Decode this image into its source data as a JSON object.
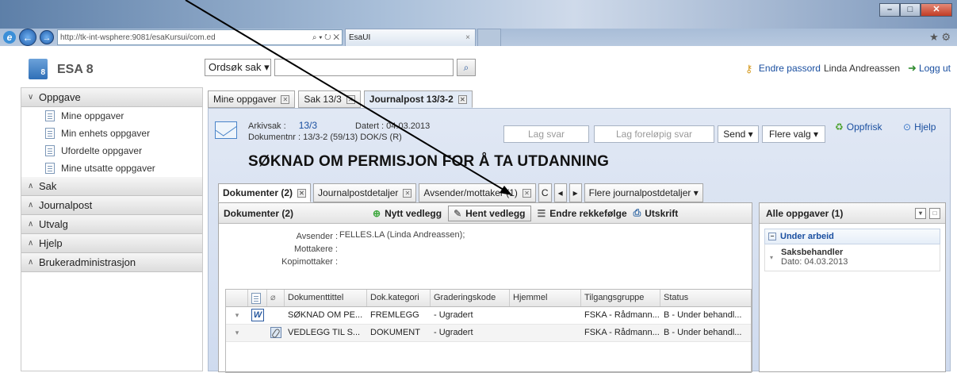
{
  "browser": {
    "address_url": "http://tk-int-wsphere:9081/esaKursui/com.ed",
    "address_host": "tk-int-wsphere",
    "address_tools": "⌕ ▾ ↻ ✕",
    "tab_title": "EsaUI",
    "tab_close": "×",
    "min": "–",
    "max": "□",
    "close": "✕",
    "star": "★ ⚙"
  },
  "app": {
    "logo_num": "8",
    "name": "ESA 8",
    "search_select": "Ordsøk sak ▾",
    "search_icon": "⌕",
    "change_password": "Endre passord",
    "username": "Linda Andreassen",
    "logout": "Logg ut"
  },
  "sidebar": {
    "sections": [
      {
        "label": "Oppgave",
        "chev": "∨"
      },
      {
        "label": "Sak",
        "chev": "∧"
      },
      {
        "label": "Journalpost",
        "chev": "∧"
      },
      {
        "label": "Utvalg",
        "chev": "∧"
      },
      {
        "label": "Hjelp",
        "chev": "∧"
      },
      {
        "label": "Brukeradministrasjon",
        "chev": "∧"
      }
    ],
    "oppgave_items": [
      "Mine oppgaver",
      "Min enhets oppgaver",
      "Ufordelte oppgaver",
      "Mine utsatte oppgaver"
    ]
  },
  "main_tabs": [
    "Mine oppgaver",
    "Sak 13/3",
    "Journalpost 13/3-2"
  ],
  "journal": {
    "arkivsak_label": "Arkivsak :",
    "arkivsak_value": "13/3",
    "datert": "Datert : 04.03.2013",
    "dokumentnr": "Dokumentnr : 13/3-2 (59/13) DOK/S (R)",
    "title": "SØKNAD OM PERMISJON FOR Å TA UTDANNING",
    "btn_lag_svar": "Lag svar",
    "btn_lag_foreløpig": "Lag foreløpig svar",
    "btn_send": "Send ▾",
    "btn_flere": "Flere valg ▾",
    "oppfrisk": "Oppfrisk",
    "hjelp": "Hjelp"
  },
  "doc_tabs": [
    "Dokumenter (2)",
    "Journalpostdetaljer",
    "Avsender/mottaker (1)",
    "C",
    "◂",
    "▸",
    "Flere journalpostdetaljer ▾"
  ],
  "docpanel": {
    "title": "Dokumenter (2)",
    "nytt": "Nytt vedlegg",
    "hent": "Hent vedlegg",
    "endre": "Endre rekkefølge",
    "utskrift": "Utskrift",
    "avsender_label": "Avsender :",
    "avsender_value": "FELLES.LA (Linda Andreassen);",
    "mottakere_label": "Mottakere :",
    "kopi_label": "Kopimottaker :",
    "columns": [
      "Dokumenttittel",
      "Dok.kategori",
      "Graderingskode",
      "Hjemmel",
      "Tilgangsgruppe",
      "Status"
    ],
    "rows": [
      {
        "title": "SØKNAD OM PE...",
        "kat": "FREMLEGG",
        "grad": "- Ugradert",
        "hjem": "",
        "tilg": "FSKA - Rådmann...",
        "status": "B - Under behandl..."
      },
      {
        "title": "VEDLEGG TIL S...",
        "kat": "DOKUMENT",
        "grad": "- Ugradert",
        "hjem": "",
        "tilg": "FSKA - Rådmann...",
        "status": "B - Under behandl..."
      }
    ]
  },
  "tasks": {
    "title": "Alle oppgaver (1)",
    "group": "Under arbeid",
    "item_title": "Saksbehandler",
    "item_date": "Dato: 04.03.2013"
  }
}
